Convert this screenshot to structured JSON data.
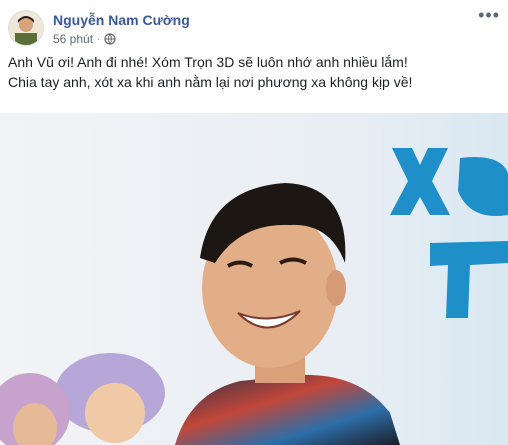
{
  "post": {
    "author_name": "Nguyễn Nam Cường",
    "time": "56 phút",
    "separator": "·",
    "privacy_icon": "globe-icon",
    "more_icon": "more-options-icon",
    "text_lines": [
      "Anh Vũ ơi! Anh đi nhé! Xóm Trọn 3D sẽ luôn nhớ anh nhiều lắm!",
      "Chia tay anh, xót xa khi anh nằm lại nơi phương xa không kịp về!"
    ],
    "more_label": "•••"
  },
  "colors": {
    "author": "#385898",
    "meta": "#616770",
    "text": "#1c1e21",
    "poster_blue": "#1f8fc9"
  }
}
